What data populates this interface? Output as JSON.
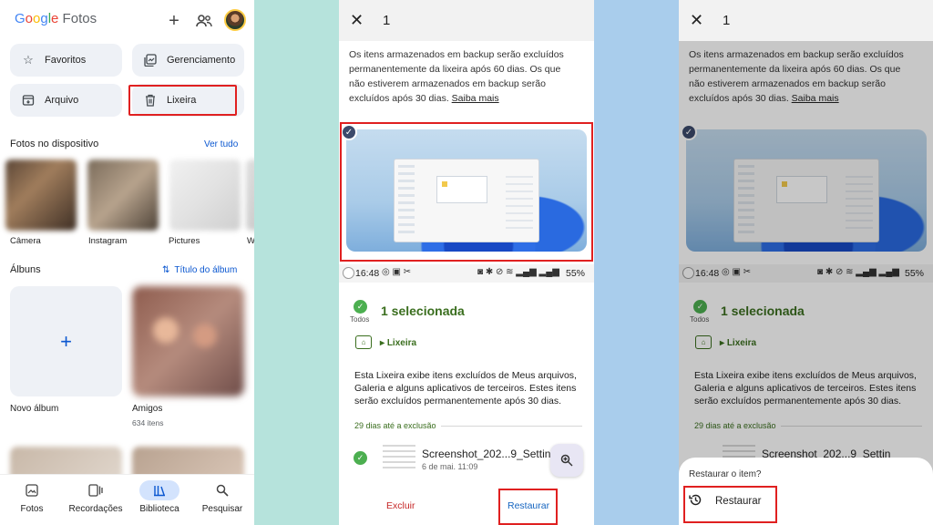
{
  "photos": {
    "logo": {
      "letters": [
        "G",
        "o",
        "o",
        "g",
        "l",
        "e"
      ],
      "rest": " Fotos"
    },
    "header": {
      "add_icon": "plus-icon",
      "share_icon": "people-icon"
    },
    "chips": [
      {
        "label": "Favoritos",
        "icon": "star-icon"
      },
      {
        "label": "Gerenciamento",
        "icon": "manage-icon"
      },
      {
        "label": "Arquivo",
        "icon": "archive-icon"
      },
      {
        "label": "Lixeira",
        "icon": "trash-icon"
      }
    ],
    "device_section": {
      "title": "Fotos no dispositivo",
      "link": "Ver tudo"
    },
    "device_folders": [
      "Câmera",
      "Instagram",
      "Pictures",
      "W"
    ],
    "albums_section": {
      "title": "Álbuns",
      "sort": "Título do álbum"
    },
    "albums": [
      {
        "label": "Novo álbum"
      },
      {
        "label": "Amigos",
        "count": "634 itens"
      }
    ],
    "nav": [
      {
        "label": "Fotos",
        "icon": "photo-icon"
      },
      {
        "label": "Recordações",
        "icon": "memories-icon"
      },
      {
        "label": "Biblioteca",
        "icon": "library-icon",
        "active": true
      },
      {
        "label": "Pesquisar",
        "icon": "search-icon"
      }
    ]
  },
  "trash": {
    "count": "1",
    "info": "Os itens armazenados em backup serão excluídos permanentemente da lixeira após 60 dias. Os que não estiverem armazenados em backup serão excluídos após 30 dias.",
    "info_link": "Saiba mais",
    "status": {
      "time": "16:48",
      "battery": "55%"
    },
    "todos": "Todos",
    "selected": "1 selecionada",
    "breadcrumb": "Lixeira",
    "description": "Esta Lixeira exibe itens excluídos de Meus arquivos, Galeria e alguns aplicativos de terceiros. Estes itens serão excluídos permanentemente após 30 dias.",
    "days_left": "29 dias até a exclusão",
    "file": {
      "name": "Screenshot_202...9_Settin",
      "date": "6 de mai. 11:09"
    },
    "actions": {
      "delete": "Excluir",
      "restore": "Restaurar"
    },
    "sheet": {
      "title": "Restaurar o item?",
      "option": "Restaurar"
    }
  },
  "colors": {
    "highlight": "#e02020",
    "accent_green": "#3a6e1e",
    "google_blue": "#0b57d0"
  }
}
